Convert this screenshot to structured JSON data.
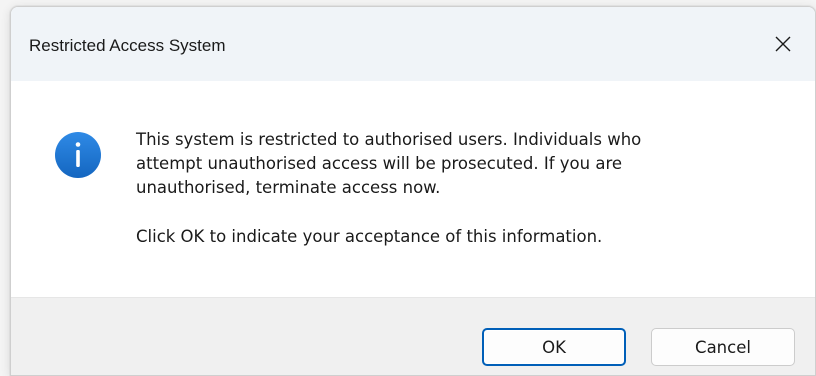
{
  "window": {
    "title": "Restricted Access System",
    "close_icon": "close-icon"
  },
  "content": {
    "icon": "info-icon",
    "icon_color": "#1e77d3",
    "line1": "This system is restricted to authorised users. Individuals who",
    "line2": "attempt unauthorised access will be prosecuted. If you are",
    "line3": "unauthorised, terminate access now.",
    "line4": "Click OK to indicate your acceptance of this information."
  },
  "buttons": {
    "ok_label": "OK",
    "cancel_label": "Cancel",
    "default_border_color": "#005fb8"
  }
}
